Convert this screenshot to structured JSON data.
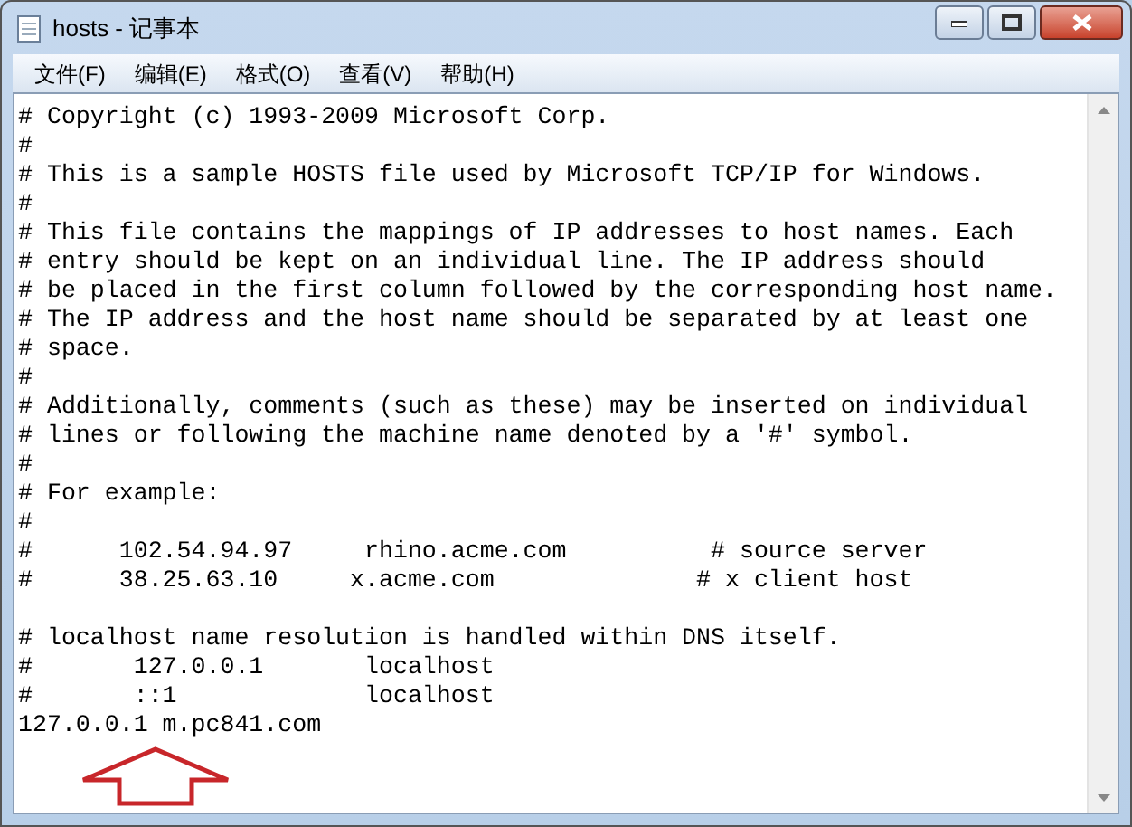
{
  "window": {
    "title": "hosts - 记事本"
  },
  "menu": [
    {
      "label": "文件(F)"
    },
    {
      "label": "编辑(E)"
    },
    {
      "label": "格式(O)"
    },
    {
      "label": "查看(V)"
    },
    {
      "label": "帮助(H)"
    }
  ],
  "document": {
    "text": "# Copyright (c) 1993-2009 Microsoft Corp.\n#\n# This is a sample HOSTS file used by Microsoft TCP/IP for Windows.\n#\n# This file contains the mappings of IP addresses to host names. Each\n# entry should be kept on an individual line. The IP address should\n# be placed in the first column followed by the corresponding host name.\n# The IP address and the host name should be separated by at least one\n# space.\n#\n# Additionally, comments (such as these) may be inserted on individual\n# lines or following the machine name denoted by a '#' symbol.\n#\n# For example:\n#\n#      102.54.94.97     rhino.acme.com          # source server\n#      38.25.63.10     x.acme.com              # x client host\n\n# localhost name resolution is handled within DNS itself.\n#       127.0.0.1       localhost\n#       ::1             localhost\n127.0.0.1 m.pc841.com"
  }
}
